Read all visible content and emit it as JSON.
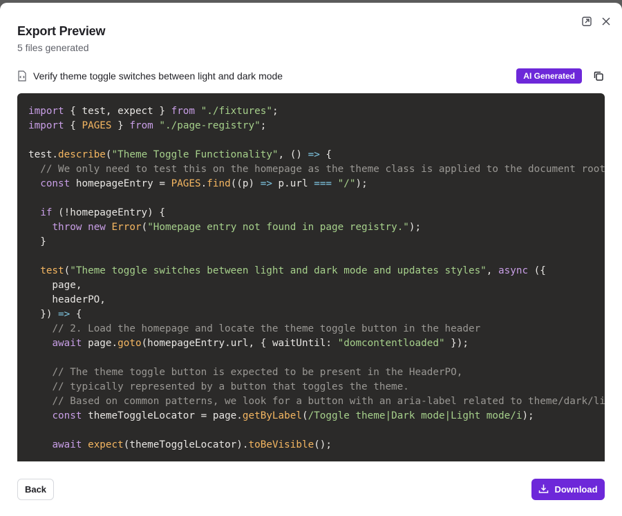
{
  "dialog": {
    "title": "Export Preview",
    "subtitle": "5 files generated"
  },
  "file": {
    "name": "Verify theme toggle switches between light and dark mode",
    "badge": "AI Generated"
  },
  "footer": {
    "back_label": "Back",
    "download_label": "Download"
  },
  "code_lines": [
    "import { test, expect } from \"./fixtures\";",
    "import { PAGES } from \"./page-registry\";",
    "",
    "test.describe(\"Theme Toggle Functionality\", () => {",
    "  // We only need to test this on the homepage as the theme class is applied to the document root (",
    "  const homepageEntry = PAGES.find((p) => p.url === \"/\");",
    "",
    "  if (!homepageEntry) {",
    "    throw new Error(\"Homepage entry not found in page registry.\");",
    "  }",
    "",
    "  test(\"Theme toggle switches between light and dark mode and updates styles\", async ({",
    "    page,",
    "    headerPO,",
    "  }) => {",
    "    // 2. Load the homepage and locate the theme toggle button in the header",
    "    await page.goto(homepageEntry.url, { waitUntil: \"domcontentloaded\" });",
    "",
    "    // The theme toggle button is expected to be present in the HeaderPO,",
    "    // typically represented by a button that toggles the theme.",
    "    // Based on common patterns, we look for a button with an aria-label related to theme/dark/ligh",
    "    const themeToggleLocator = page.getByLabel(/Toggle theme|Dark mode|Light mode/i);",
    "",
    "    await expect(themeToggleLocator).toBeVisible();"
  ],
  "colors": {
    "accent": "#6d28d9",
    "code_bg": "#2b2a29"
  },
  "icons": [
    "external-link-icon",
    "close-icon",
    "file-code-icon",
    "copy-icon",
    "download-icon"
  ]
}
